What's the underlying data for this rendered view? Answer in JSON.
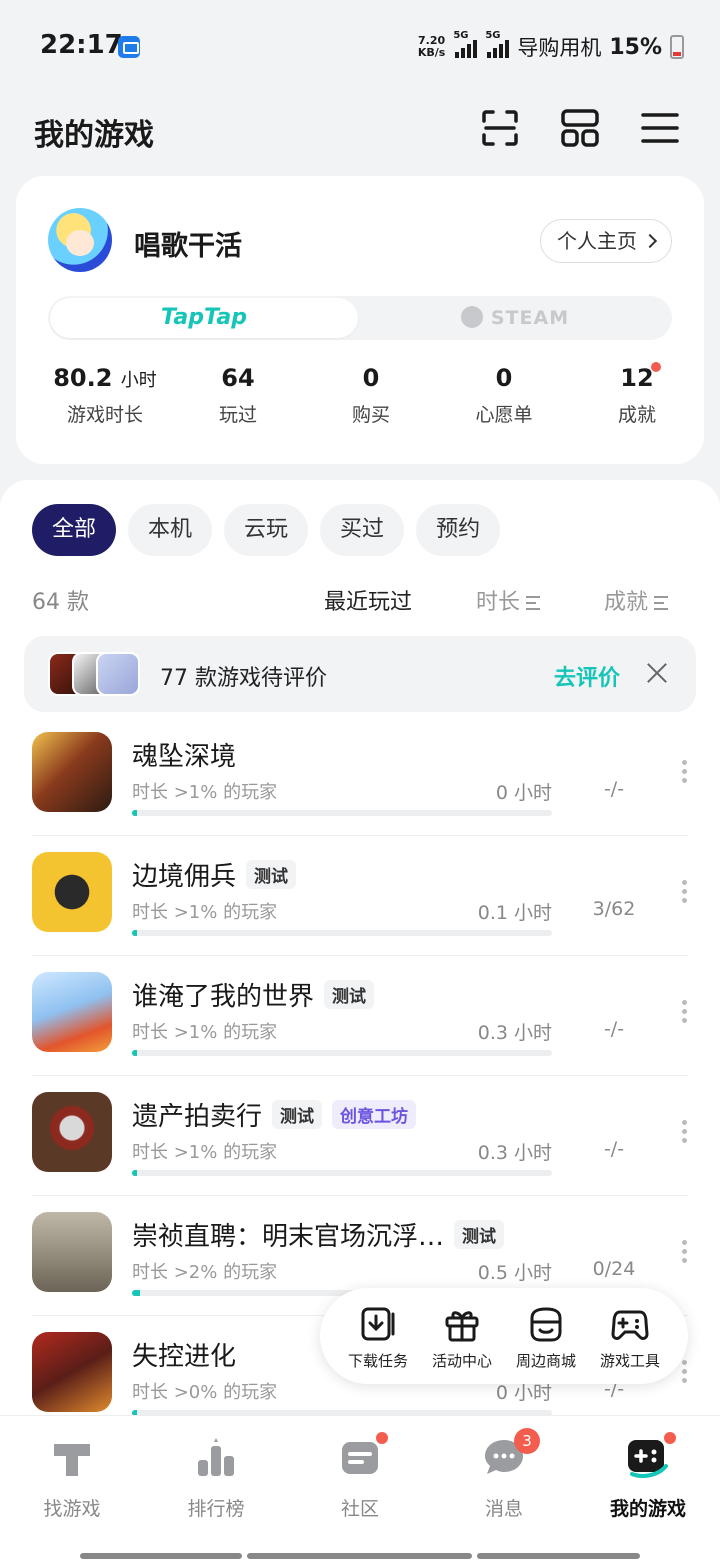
{
  "status_bar": {
    "time": "22:17",
    "speed_value": "7.20",
    "speed_unit": "KB/s",
    "net1": "5G",
    "net2": "5G",
    "carrier": "导购用机",
    "battery": "15%"
  },
  "header": {
    "title": "我的游戏",
    "icons": [
      "scan-icon",
      "grid-icon",
      "menu-icon"
    ]
  },
  "profile": {
    "username": "唱歌干活",
    "homepage_label": "个人主页",
    "platforms": [
      "TapTap",
      "STEAM"
    ],
    "stats": [
      {
        "value": "80.2",
        "unit": "小时",
        "label": "游戏时长"
      },
      {
        "value": "64",
        "label": "玩过"
      },
      {
        "value": "0",
        "label": "购买"
      },
      {
        "value": "0",
        "label": "心愿单"
      },
      {
        "value": "12",
        "label": "成就"
      }
    ]
  },
  "filters": [
    "全部",
    "本机",
    "云玩",
    "买过",
    "预约"
  ],
  "sort": {
    "count": "64 款",
    "recent": "最近玩过",
    "duration": "时长",
    "achievement": "成就"
  },
  "review_banner": {
    "text": "77 款游戏待评价",
    "action": "去评价"
  },
  "games": [
    {
      "name": "魂坠深境",
      "tags": [],
      "desc": "时长 >1% 的玩家",
      "hours": "0 小时",
      "progress": 0.01,
      "ach": "-/-"
    },
    {
      "name": "边境佣兵",
      "tags": [
        "测试"
      ],
      "desc": "时长 >1% 的玩家",
      "hours": "0.1 小时",
      "progress": 0.01,
      "ach": "3/62"
    },
    {
      "name": "谁淹了我的世界",
      "tags": [
        "测试"
      ],
      "desc": "时长 >1% 的玩家",
      "hours": "0.3 小时",
      "progress": 0.01,
      "ach": "-/-"
    },
    {
      "name": "遗产拍卖行",
      "tags": [
        "测试",
        "创意工坊"
      ],
      "desc": "时长 >1% 的玩家",
      "hours": "0.3 小时",
      "progress": 0.01,
      "ach": "-/-"
    },
    {
      "name": "崇祯直聘：明末官场沉浮…",
      "tags": [
        "测试"
      ],
      "desc": "时长 >2% 的玩家",
      "hours": "0.5 小时",
      "progress": 0.02,
      "ach": "0/24"
    },
    {
      "name": "失控进化",
      "tags": [],
      "desc": "时长 >0% 的玩家",
      "hours": "0 小时",
      "progress": 0.01,
      "ach": "-/-"
    }
  ],
  "float_toolbar": [
    {
      "label": "下载任务",
      "icon": "download-icon"
    },
    {
      "label": "活动中心",
      "icon": "gift-icon"
    },
    {
      "label": "周边商城",
      "icon": "shop-icon"
    },
    {
      "label": "游戏工具",
      "icon": "gamepad-icon"
    }
  ],
  "bottom_nav": [
    {
      "label": "找游戏",
      "icon": "taptap-icon"
    },
    {
      "label": "排行榜",
      "icon": "ranking-icon"
    },
    {
      "label": "社区",
      "icon": "community-icon"
    },
    {
      "label": "消息",
      "icon": "message-icon",
      "badge": "3"
    },
    {
      "label": "我的游戏",
      "icon": "my-games-icon"
    }
  ],
  "colors": {
    "accent": "#15c5b8",
    "active_chip": "#1f1d66",
    "badge": "#f25d4e",
    "workshop_tag": "#6b55e0"
  }
}
